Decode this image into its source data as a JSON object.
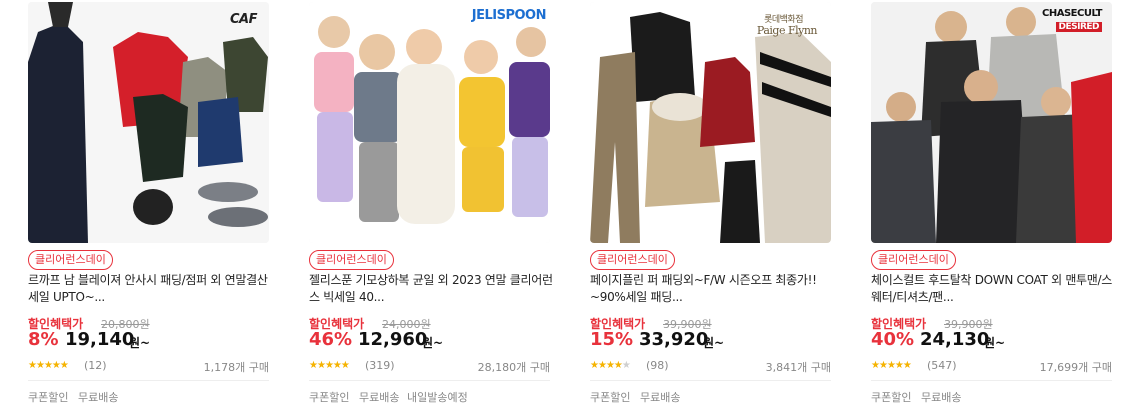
{
  "products": [
    {
      "brand_logo": "CAF",
      "tag": "클리어런스데이",
      "title": "르까프 남 블레이져 안사시 패딩/점퍼 외 연말결산 세일 UPTO~...",
      "price_label": "할인혜택가",
      "original_price": "20,800원",
      "discount": "8%",
      "price": "19,140",
      "currency": "원~",
      "rating": 4.5,
      "stars": "★★★★★",
      "reviews": "(12)",
      "sold": "1,178개 구매",
      "services": [
        "쿠폰할인",
        "무료배송"
      ]
    },
    {
      "brand_logo": "JELISPOON",
      "tag": "클리어런스데이",
      "title": "젤리스푼 기모상하복 균일 외 2023 연말 클리어런스 빅세일 40...",
      "price_label": "할인혜택가",
      "original_price": "24,000원",
      "discount": "46%",
      "price": "12,960",
      "currency": "원~",
      "rating": 4.5,
      "stars": "★★★★★",
      "reviews": "(319)",
      "sold": "28,180개 구매",
      "services": [
        "쿠폰할인",
        "무료배송",
        "내일발송예정"
      ]
    },
    {
      "brand_logo": "Paige Flynn",
      "brand_sub": "롯데백화점",
      "tag": "클리어런스데이",
      "title": "페이지플린 퍼 패딩외~F/W 시즌오프 최종가!! ~90%세일 패딩...",
      "price_label": "할인혜택가",
      "original_price": "39,900원",
      "discount": "15%",
      "price": "33,920",
      "currency": "원~",
      "rating": 4.0,
      "stars": "★★★★★",
      "reviews": "(98)",
      "sold": "3,841개 구매",
      "services": [
        "쿠폰할인",
        "무료배송"
      ]
    },
    {
      "brand_logo": "CHASECULT",
      "brand_sub": "DESIRED",
      "tag": "클리어런스데이",
      "title": "체이스컬트 후드탈착 DOWN COAT 외 맨투맨/스웨터/티셔츠/팬...",
      "price_label": "할인혜택가",
      "original_price": "39,900원",
      "discount": "40%",
      "price": "24,130",
      "currency": "원~",
      "rating": 4.5,
      "stars": "★★★★★",
      "reviews": "(547)",
      "sold": "17,699개 구매",
      "services": [
        "쿠폰할인",
        "무료배송"
      ]
    }
  ],
  "colors": {
    "accent": "#e8323c",
    "star": "#f5b301",
    "muted": "#888888"
  }
}
